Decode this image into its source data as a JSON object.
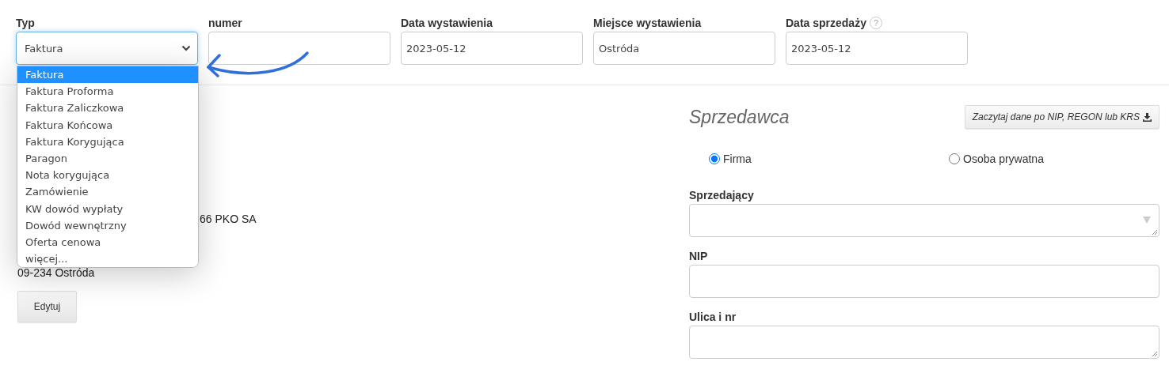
{
  "header_fields": [
    {
      "kind": "select",
      "label": "Typ",
      "value": "Faktura"
    },
    {
      "kind": "input",
      "label": "numer"
    },
    {
      "kind": "input",
      "label": "Data wystawienia",
      "value": "2023-05-12"
    },
    {
      "kind": "input",
      "label": "Miejsce wystawienia",
      "value": "Ostróda"
    },
    {
      "kind": "input",
      "label": "Data sprzedaży",
      "value": "2023-05-12",
      "help": "?"
    }
  ],
  "type_dropdown": {
    "options": [
      {
        "label": "Faktura",
        "selected": true
      },
      {
        "label": "Faktura Proforma",
        "selected": false
      },
      {
        "label": "Faktura Zaliczkowa",
        "selected": false
      },
      {
        "label": "Faktura Końcowa",
        "selected": false
      },
      {
        "label": "Faktura Korygująca",
        "selected": false
      },
      {
        "label": "Paragon",
        "selected": false
      },
      {
        "label": "Nota korygująca",
        "selected": false
      },
      {
        "label": "Zamówienie",
        "selected": false
      },
      {
        "label": "KW dowód wypłaty",
        "selected": false
      },
      {
        "label": "Dowód wewnętrzny",
        "selected": false
      },
      {
        "label": "Oferta cenowa",
        "selected": false
      },
      {
        "label": "więcej...",
        "selected": false
      }
    ]
  },
  "buyer": {
    "bank_line": "66 PKO SA",
    "address_line": "09-234 Ostróda",
    "edit_button": "Edytuj"
  },
  "seller": {
    "title": "Sprzedawca",
    "fetch_button": "Zaczytaj dane po NIP, REGON lub KRS",
    "types": [
      {
        "label": "Firma",
        "selected": true
      },
      {
        "label": "Osoba prywatna",
        "selected": false
      }
    ],
    "fields": [
      {
        "kind": "select",
        "label": "Sprzedający"
      },
      {
        "kind": "input",
        "label": "NIP"
      },
      {
        "kind": "textarea",
        "label": "Ulica i nr"
      }
    ]
  }
}
